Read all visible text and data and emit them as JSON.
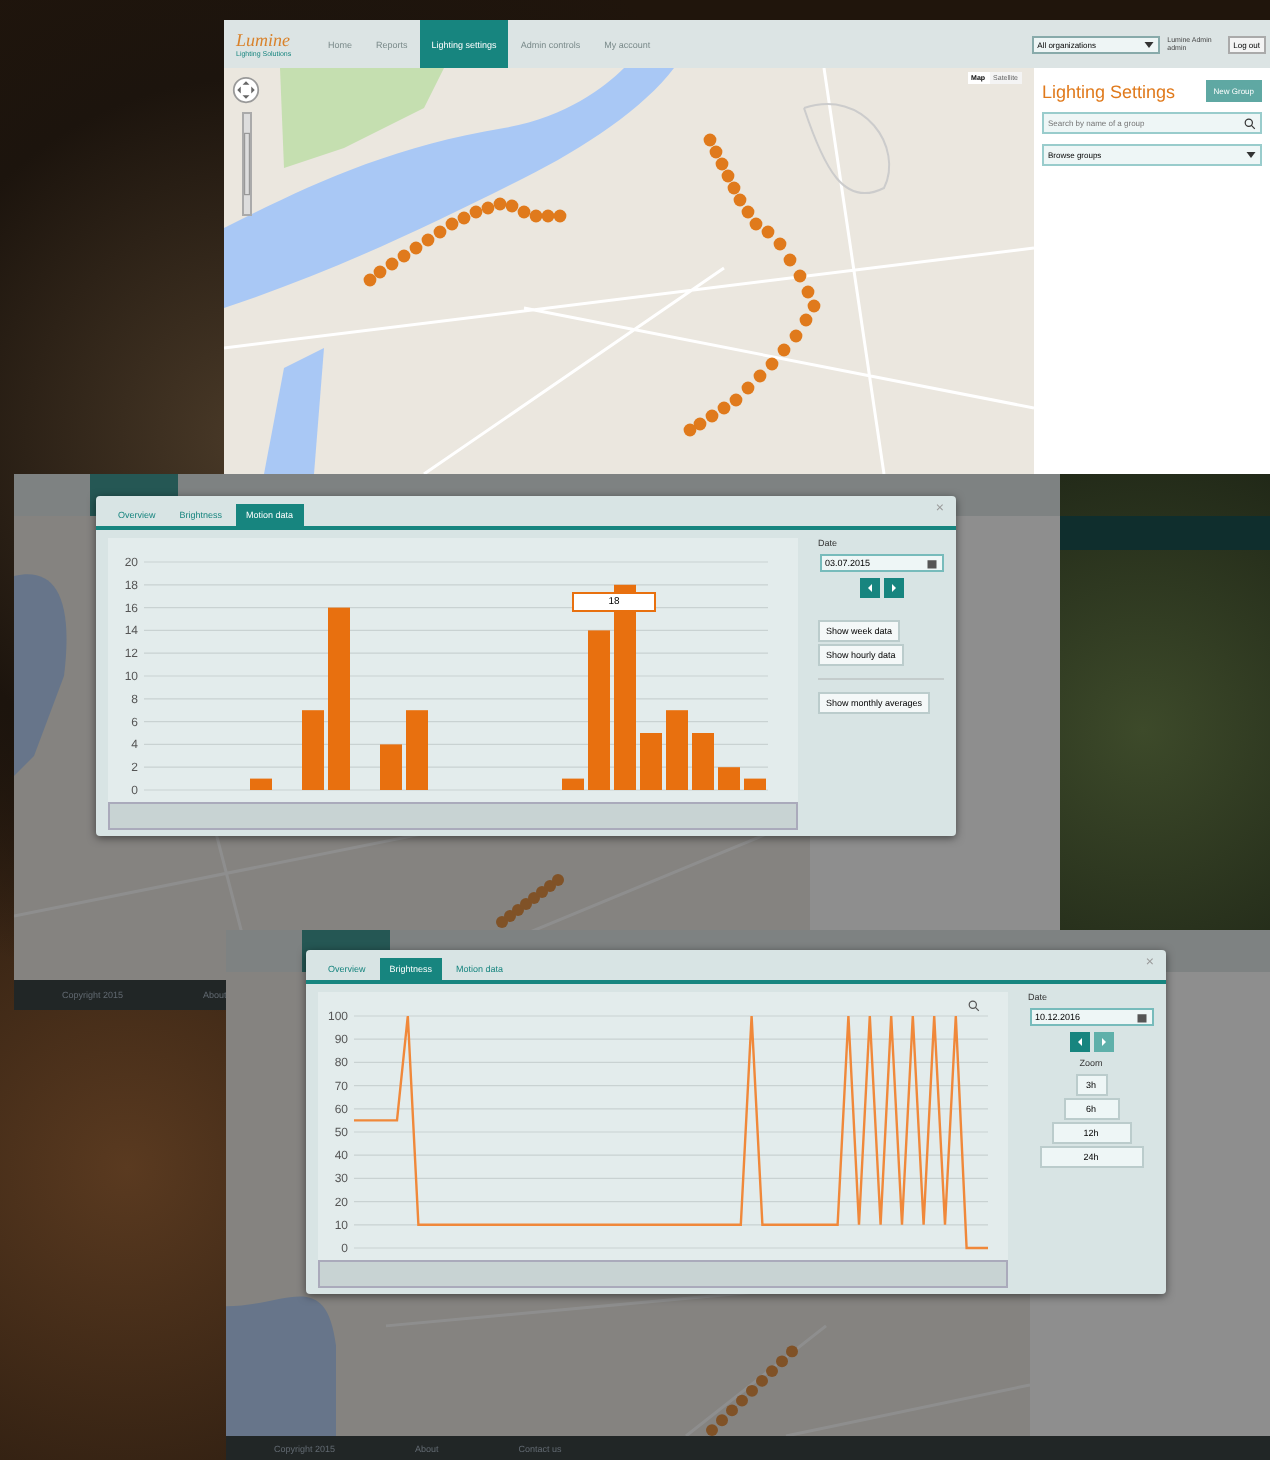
{
  "main_screen": {
    "logo": {
      "name": "Lumine",
      "tagline": "Lighting Solutions"
    },
    "nav": [
      {
        "label": "Home",
        "selected": false
      },
      {
        "label": "Reports",
        "selected": false
      },
      {
        "label": "Lighting settings",
        "selected": true
      },
      {
        "label": "Admin controls",
        "selected": false
      },
      {
        "label": "My account",
        "selected": false
      }
    ],
    "organization_select": "All organizations",
    "user": {
      "name": "Lumine Admin",
      "role": "admin"
    },
    "logout": "Log out",
    "map_types": [
      {
        "label": "Map",
        "selected": true
      },
      {
        "label": "Satellite",
        "selected": false
      }
    ],
    "panel": {
      "title": "Lighting Settings",
      "new_button": "New Group",
      "search": {
        "placeholder": "Search by name of a group"
      },
      "browse": "Browse groups"
    }
  },
  "motion_screen": {
    "footer": [
      "Copyright 2015",
      "About"
    ],
    "dialog": {
      "close_glyph": "×",
      "tabs": [
        {
          "label": "Overview",
          "selected": false
        },
        {
          "label": "Brightness",
          "selected": false
        },
        {
          "label": "Motion data",
          "selected": true
        }
      ],
      "chart_data": {
        "type": "bar",
        "grid": true,
        "categories": [
          null,
          null,
          null,
          null,
          null,
          null,
          null,
          null,
          null,
          null,
          null,
          null,
          null,
          null,
          null,
          null,
          null,
          null,
          null,
          null,
          null,
          null,
          null,
          null
        ],
        "values": [
          0,
          0,
          0,
          0,
          1,
          0,
          7,
          16,
          0,
          4,
          7,
          0,
          0,
          0,
          0,
          0,
          1,
          14,
          18,
          5,
          7,
          5,
          2,
          1
        ],
        "ylim": [
          0,
          20
        ],
        "yticks": [
          0,
          2,
          4,
          6,
          8,
          10,
          12,
          14,
          16,
          18,
          20
        ]
      },
      "tooltip": "18",
      "date": {
        "label": "Date",
        "value": "03.07.2015"
      },
      "buttons": [
        "Show week data",
        "Show hourly data"
      ],
      "extra_button": "Show monthly averages"
    }
  },
  "brightness_screen": {
    "footer": [
      "Copyright 2015",
      "About",
      "Contact us"
    ],
    "dialog": {
      "close_glyph": "×",
      "tabs": [
        {
          "label": "Overview",
          "selected": false
        },
        {
          "label": "Brightness",
          "selected": true
        },
        {
          "label": "Motion data",
          "selected": false
        }
      ],
      "chart_data": {
        "type": "line",
        "grid": true,
        "categories": [
          null,
          null,
          null,
          null,
          null,
          null,
          null,
          null,
          null,
          null,
          null,
          null,
          null,
          null,
          null,
          null,
          null,
          null,
          null,
          null,
          null,
          null,
          null,
          null,
          null,
          null,
          null,
          null,
          null,
          null,
          null,
          null,
          null,
          null,
          null,
          null,
          null,
          null,
          null,
          null,
          null,
          null,
          null,
          null,
          null,
          null,
          null,
          null,
          null,
          null,
          null,
          null,
          null,
          null,
          null,
          null,
          null,
          null,
          null,
          null
        ],
        "series": [
          {
            "color": "#f0883a",
            "values": [
              55,
              55,
              55,
              55,
              55,
              100,
              10,
              10,
              10,
              10,
              10,
              10,
              10,
              10,
              10,
              10,
              10,
              10,
              10,
              10,
              10,
              10,
              10,
              10,
              10,
              10,
              10,
              10,
              10,
              10,
              10,
              10,
              10,
              10,
              10,
              10,
              10,
              100,
              10,
              10,
              10,
              10,
              10,
              10,
              10,
              10,
              100,
              10,
              100,
              10,
              100,
              10,
              100,
              10,
              100,
              10,
              100,
              0,
              0,
              0
            ]
          }
        ],
        "ylim": [
          0,
          100
        ],
        "yticks": [
          0,
          10,
          20,
          30,
          40,
          50,
          60,
          70,
          80,
          90,
          100
        ]
      },
      "date": {
        "label": "Date",
        "value": "10.12.2016"
      },
      "zoom": {
        "label": "Zoom",
        "options": [
          "3h",
          "6h",
          "12h",
          "24h"
        ]
      }
    }
  }
}
